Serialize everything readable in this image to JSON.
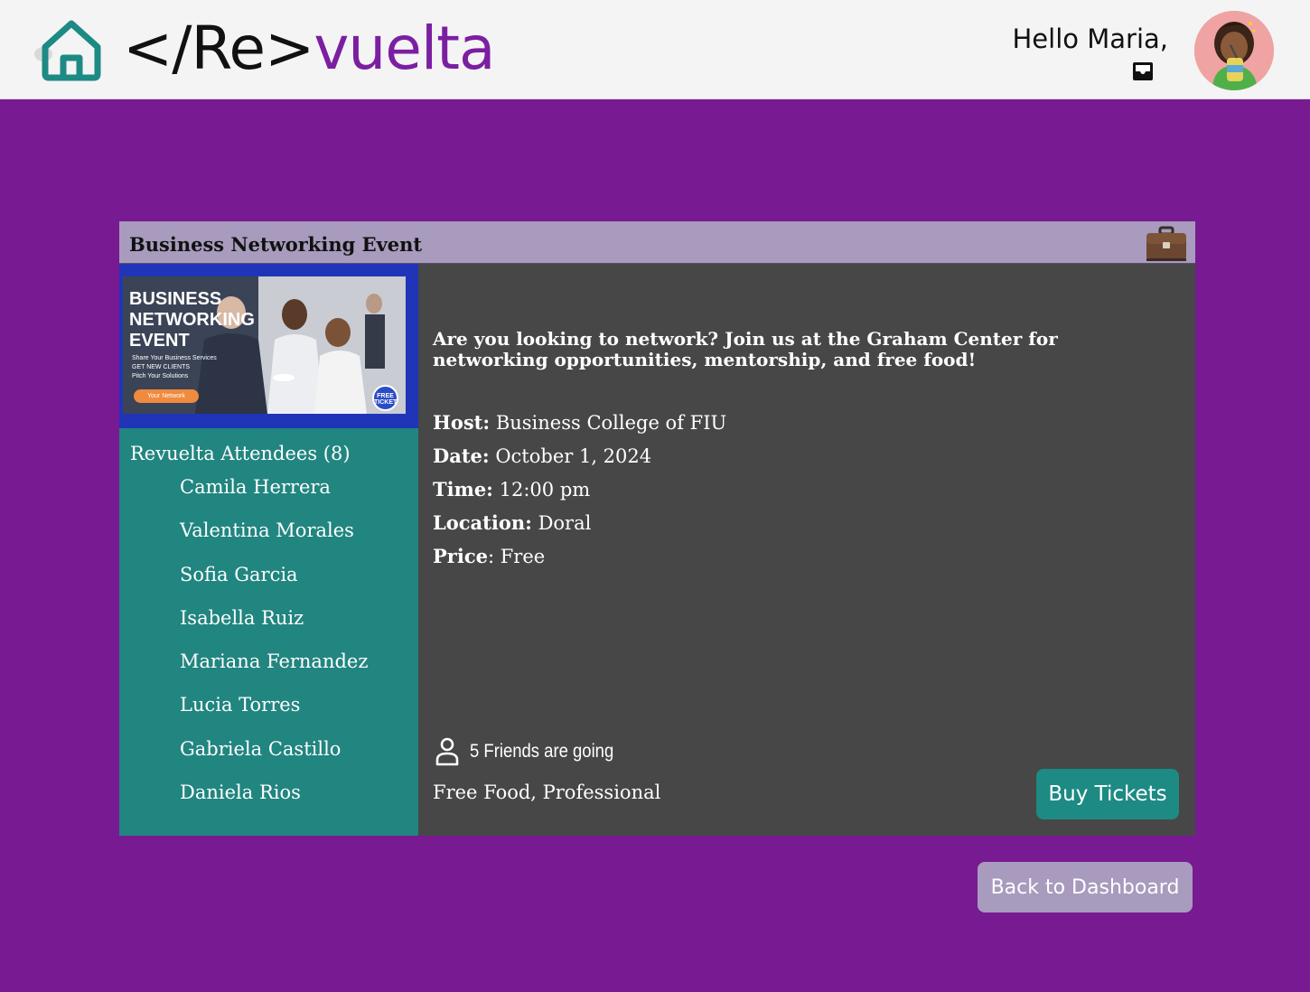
{
  "header": {
    "brand_part1": "</Re>",
    "brand_part2": "vuelta",
    "greeting": "Hello Maria,",
    "home_icon": "home-icon",
    "inbox_icon": "inbox-icon",
    "colors": {
      "brand": "#7b1fa2",
      "home": "#1d8a84",
      "background": "#f4f4f4"
    }
  },
  "event": {
    "title": "Business Networking Event",
    "category_icon": "briefcase-icon",
    "banner": {
      "heading": "BUSINESS NETWORKING EVENT",
      "lines": [
        "Share Your Business Services",
        "GET NEW CLIENTS",
        "Pitch Your Solutions"
      ],
      "pill": "Your Network",
      "badge": "FREE TICKET"
    },
    "description": "Are you looking to network? Join us at the Graham Center for networking opportunities, mentorship, and free food!",
    "details": [
      {
        "label": "Host:",
        "value": "Business College of FIU"
      },
      {
        "label": "Date:",
        "value": "October 1, 2024"
      },
      {
        "label": "Time:",
        "value": "12:00 pm"
      },
      {
        "label": "Location:",
        "value": "Doral"
      },
      {
        "label": "Price",
        "value": ": Free"
      }
    ],
    "friends_going": "5 Friends are going",
    "tags": "Free Food, Professional",
    "buy_label": "Buy Tickets"
  },
  "attendees": {
    "title": "Revuelta Attendees (8)",
    "names": [
      "Camila Herrera",
      "Valentina Morales",
      "Sofia Garcia",
      "Isabella Ruiz",
      "Mariana Fernandez",
      "Lucia Torres",
      "Gabriela Castillo",
      "Daniela Rios"
    ]
  },
  "footer": {
    "back_label": "Back to Dashboard"
  },
  "colors": {
    "page_bg": "#781a92",
    "teal": "#218580",
    "panel": "#474747",
    "lavender": "#a89bbd"
  }
}
